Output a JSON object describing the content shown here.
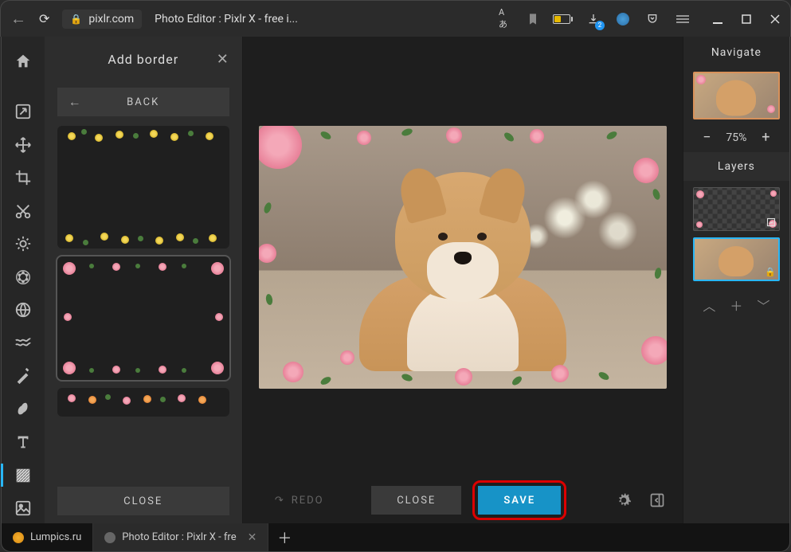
{
  "browser": {
    "url_host": "pixlr.com",
    "page_title": "Photo Editor : Pixlr X - free i...",
    "download_badge": "2"
  },
  "panel": {
    "title": "Add border",
    "back_label": "BACK",
    "close_label": "CLOSE"
  },
  "canvas_footer": {
    "redo_label": "REDO",
    "close_label": "CLOSE",
    "save_label": "SAVE"
  },
  "right": {
    "navigate_label": "Navigate",
    "zoom_minus": "−",
    "zoom_value": "75%",
    "zoom_plus": "+",
    "layers_label": "Layers"
  },
  "tabs": {
    "tab1_label": "Lumpics.ru",
    "tab2_label": "Photo Editor : Pixlr X - fre"
  },
  "tools": [
    "home",
    "open",
    "arrange",
    "crop",
    "cut",
    "adjust",
    "filter",
    "liquify",
    "retouch",
    "brush",
    "text",
    "border",
    "add"
  ]
}
